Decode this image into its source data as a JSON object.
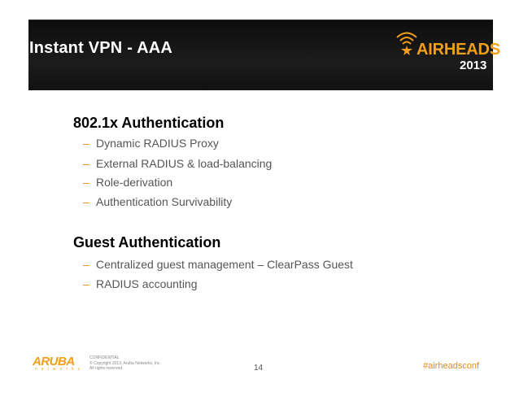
{
  "header": {
    "title": "Instant VPN - AAA",
    "logo_word": "AIRHEADS",
    "logo_year": "2013"
  },
  "sections": [
    {
      "heading": "802.1x Authentication",
      "bullets": [
        "Dynamic RADIUS Proxy",
        "External RADIUS & load-balancing",
        "Role-derivation",
        "Authentication Survivability"
      ]
    },
    {
      "heading": "Guest Authentication",
      "bullets": [
        "Centralized guest management – ClearPass Guest",
        "RADIUS accounting"
      ]
    }
  ],
  "footer": {
    "brand": "ARUBA",
    "brand_sub": "networks",
    "confidential": "CONFIDENTIAL",
    "copyright": "© Copyright 2013. Aruba Networks, Inc.",
    "rights": "All rights reserved",
    "page_number": "14",
    "hashtag": "#airheadsconf"
  },
  "colors": {
    "accent": "#e08a1a",
    "header_bg": "#141414",
    "title_text": "#ffffff"
  },
  "bullet_marker": "–"
}
